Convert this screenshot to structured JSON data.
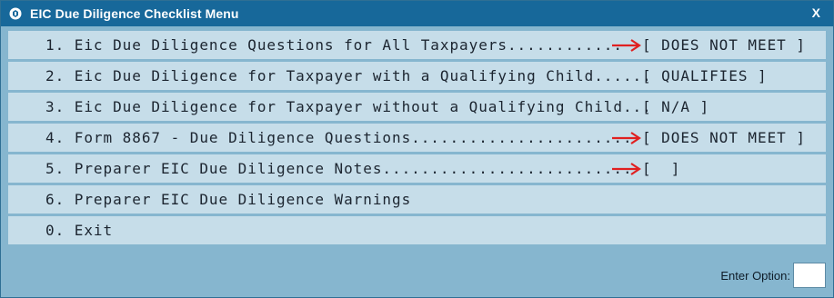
{
  "window": {
    "title": "EIC Due Diligence Checklist Menu",
    "close_label": "X",
    "icon": "app-icon"
  },
  "menu": {
    "items": [
      {
        "label": "1. Eic Due Diligence Questions for All Taxpayers............",
        "status": "[ DOES NOT MEET ]",
        "arrow": true
      },
      {
        "label": "2. Eic Due Diligence for Taxpayer with a Qualifying Child......",
        "status": "[ QUALIFIES ]",
        "arrow": false
      },
      {
        "label": "3. Eic Due Diligence for Taxpayer without a Qualifying Child...",
        "status": "[ N/A ]",
        "arrow": false
      },
      {
        "label": "4. Form 8867 - Due Diligence Questions.......................",
        "status": "[ DOES NOT MEET ]",
        "arrow": true
      },
      {
        "label": "5. Preparer EIC Due Diligence Notes..........................",
        "status": "[  ]",
        "arrow": true
      },
      {
        "label": "6. Preparer EIC Due Diligence Warnings",
        "status": "",
        "arrow": false
      },
      {
        "label": "0. Exit",
        "status": "",
        "arrow": false
      }
    ]
  },
  "footer": {
    "enter_option_label": "Enter Option:",
    "enter_option_value": ""
  },
  "colors": {
    "titlebar": "#17689a",
    "row_background": "#c6dde9",
    "panel_background": "#86b6cf",
    "arrow": "#e02020"
  }
}
